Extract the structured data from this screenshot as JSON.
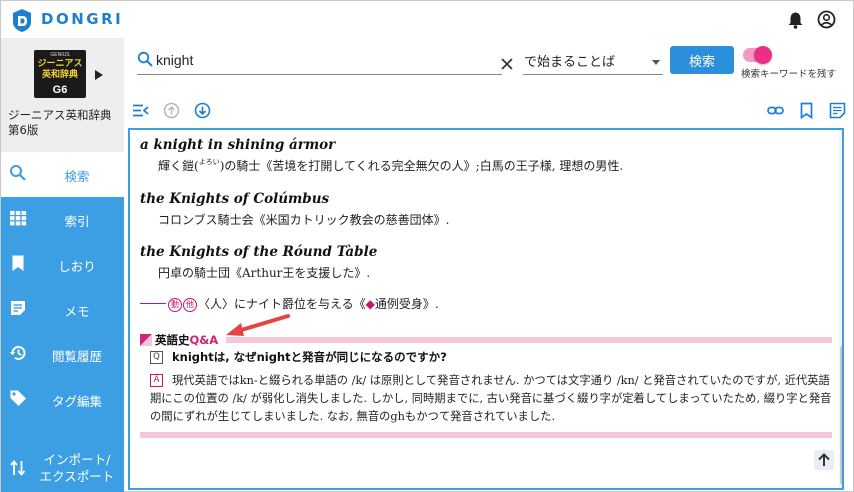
{
  "app": {
    "logo_text": "DONGRI",
    "brand_color": "#1e7fd0"
  },
  "header": {
    "icons": [
      "bell-icon",
      "account-icon"
    ]
  },
  "dictionary": {
    "cover_series": "GENIUS",
    "cover_title": "ジーニアス英和辞典",
    "cover_version": "G6",
    "name": "ジーニアス英和辞典第6版"
  },
  "sidebar": {
    "items": [
      {
        "label": "検索",
        "icon": "search-icon",
        "active": true
      },
      {
        "label": "索引",
        "icon": "grid-icon",
        "active": false
      },
      {
        "label": "しおり",
        "icon": "bookmark-icon",
        "active": false
      },
      {
        "label": "メモ",
        "icon": "memo-icon",
        "active": false
      },
      {
        "label": "閲覧履歴",
        "icon": "history-icon",
        "active": false
      },
      {
        "label": "タグ編集",
        "icon": "tag-icon",
        "active": false
      },
      {
        "label_line1": "インポート/",
        "label_line2": "エクスポート",
        "icon": "import-export-icon",
        "active": false
      }
    ],
    "color": "#3d9fe3"
  },
  "search": {
    "query": "knight",
    "mode": "で始まることば",
    "button_label": "検索",
    "keep_keyword_label": "検索キーワードを残す",
    "keep_keyword_on": true
  },
  "toolbar": {
    "icons": [
      "collapse-icon",
      "up-circle-icon",
      "down-circle-icon",
      "link-icon",
      "bookmark-outline-icon",
      "memo-outline-icon"
    ]
  },
  "entry": {
    "phrases": [
      {
        "phrase": "a knight in shining ármor",
        "def_a": "輝く鎧(",
        "def_ruby": "よろい",
        "def_b": ")の騎士《苦境を打開してくれる完全無欠の人》;白馬の王子様, 理想の男性."
      },
      {
        "phrase": "the Knights of Colúmbus",
        "def_a": "コロンブス騎士会《米国カトリック教会の慈善団体》.",
        "def_ruby": "",
        "def_b": ""
      },
      {
        "phrase": "the Knights of the Róund Tàble",
        "def_a": "円卓の騎士団《Arthur王を支援した》.",
        "def_ruby": "",
        "def_b": ""
      }
    ],
    "derivation": {
      "badge1": "動",
      "badge2": "他",
      "text_a": "〈人〉にナイト爵位を与える《",
      "diamond": "◆",
      "text_b": "通例受身》."
    },
    "qa": {
      "heading_a": "英語史",
      "heading_b": "Q&A",
      "q_label": "Q",
      "a_label": "A",
      "question": "knightは, なぜnightと発音が同じになるのですか?",
      "answer": "現代英語ではkn-と綴られる単語の /k/ は原則として発音されません. かつては文字通り /kn/ と発音されていたのですが, 近代英語期にこの位置の /k/ が弱化し消失しました. しかし, 同時期までに, 古い発音に基づく綴り字が定着してしまっていたため, 綴り字と発音の間にずれが生じてしまいました. なお, 無音のghもかつて発音されていました."
    },
    "accent_color": "#d0237a"
  }
}
